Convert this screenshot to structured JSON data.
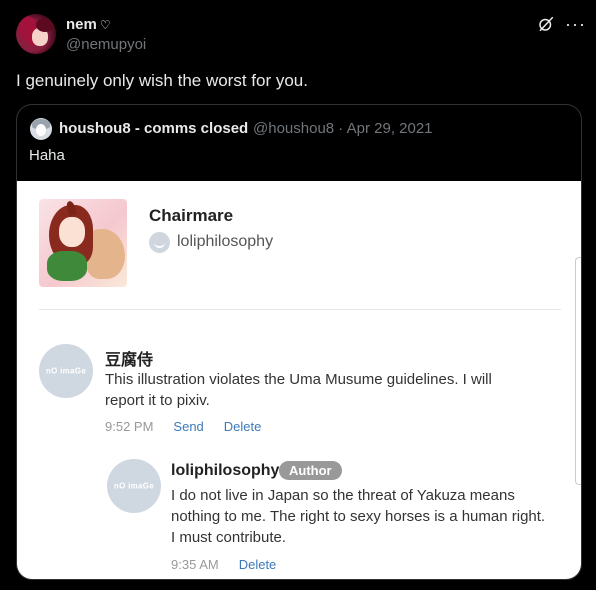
{
  "tweet": {
    "name": "nem",
    "name_suffix": "♡",
    "handle": "@nemupyoi",
    "text": "I genuinely only wish the worst for you."
  },
  "icons": {
    "grok": "grok-icon",
    "more": "more-icon",
    "more_glyph": "···"
  },
  "quote": {
    "name": "houshou8 - comms closed",
    "handle_date": "@houshou8 · Apr 29, 2021",
    "text": "Haha"
  },
  "screenshot": {
    "post_title": "Chairmare",
    "post_author": "loliphilosophy",
    "no_image_label": "nO imaGe",
    "comment1": {
      "name": "豆腐侍",
      "text": "This illustration violates the Uma Musume guidelines. I will report it to pixiv.",
      "time": "9:52 PM",
      "action1": "Send",
      "action2": "Delete"
    },
    "comment2": {
      "name": "loliphilosophy",
      "badge": "Author",
      "text": "I do not live in Japan so the threat of Yakuza means nothing to me. The right to sexy horses is a human right. I must contribute.",
      "time": "9:35 AM",
      "action1": "Delete"
    }
  },
  "colors": {
    "background": "#000000",
    "text": "#e7e9ea",
    "muted": "#71767b",
    "border": "#2f3336",
    "link_blue": "#3d7ab8",
    "badge_gray": "#999999"
  }
}
